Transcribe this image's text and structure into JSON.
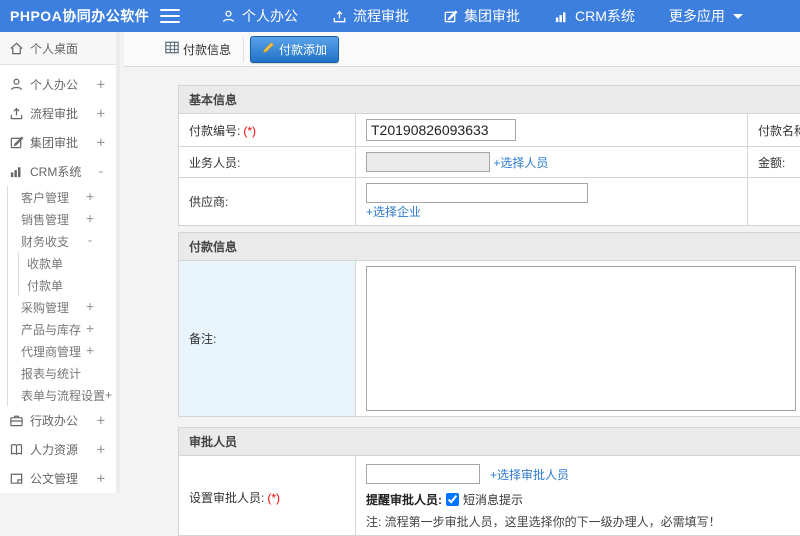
{
  "colors": {
    "topbar_bg": "#3D7FDE",
    "active_tab_top": "#59A3EA",
    "active_tab_bottom": "#2071C6",
    "link_blue": "#2E7CD0",
    "required_red": "#EE0000",
    "section_header_bg": "#EAEAEA",
    "note_cell_bg": "#E9F5FC"
  },
  "topbar": {
    "title": "PHPOA协同办公软件",
    "items": [
      {
        "icon": "user-icon",
        "label": "个人办公"
      },
      {
        "icon": "share-icon",
        "label": "流程审批"
      },
      {
        "icon": "edit-icon",
        "label": "集团审批"
      },
      {
        "icon": "chart-icon",
        "label": "CRM系统"
      },
      {
        "icon": "caret-down-icon",
        "label": "更多应用"
      }
    ]
  },
  "sidebar": {
    "items": [
      {
        "icon": "home-icon",
        "label": "个人桌面",
        "expand": ""
      },
      {
        "icon": "user-icon",
        "label": "个人办公",
        "expand": "+"
      },
      {
        "icon": "share-icon",
        "label": "流程审批",
        "expand": "+"
      },
      {
        "icon": "edit-icon",
        "label": "集团审批",
        "expand": "+"
      },
      {
        "icon": "chart-icon",
        "label": "CRM系统",
        "expand": "-"
      },
      {
        "label": "客户管理",
        "expand": "+"
      },
      {
        "label": "销售管理",
        "expand": "+"
      },
      {
        "label": "财务收支",
        "expand": "-"
      },
      {
        "label": "收款单",
        "expand": ""
      },
      {
        "label": "付款单",
        "expand": ""
      },
      {
        "label": "采购管理",
        "expand": "+"
      },
      {
        "label": "产品与库存",
        "expand": "+"
      },
      {
        "label": "代理商管理",
        "expand": "+"
      },
      {
        "label": "报表与统计",
        "expand": ""
      },
      {
        "label": "表单与流程设置",
        "expand": "+"
      },
      {
        "icon": "briefcase-icon",
        "label": "行政办公",
        "expand": "+"
      },
      {
        "icon": "book-icon",
        "label": "人力资源",
        "expand": "+"
      },
      {
        "icon": "doc-icon",
        "label": "公文管理",
        "expand": "+"
      }
    ]
  },
  "tabs": [
    {
      "label": "付款信息",
      "icon": "table-icon",
      "active": false
    },
    {
      "label": "付款添加",
      "icon": "pencil-icon",
      "active": true
    }
  ],
  "form": {
    "basic": {
      "title": "基本信息",
      "payno_label": "付款编号:",
      "payno_required": "(*)",
      "payno_value": "T20190826093633",
      "payname_label": "付款名称:",
      "payname_required": "(*)",
      "staff_label": "业务人员:",
      "staff_link": "+选择人员",
      "amount_label": "金额:",
      "supplier_label": "供应商:",
      "supplier_link": "+选择企业"
    },
    "payment": {
      "title": "付款信息",
      "memo_label": "备注:"
    },
    "approver": {
      "title": "审批人员",
      "set_label": "设置审批人员:",
      "set_required": "(*)",
      "set_link": "+选择审批人员",
      "remind_label": "提醒审批人员:",
      "checkbox_label": "短消息提示",
      "note": "注: 流程第一步审批人员，这里选择你的下一级办理人，必需填写！"
    }
  }
}
